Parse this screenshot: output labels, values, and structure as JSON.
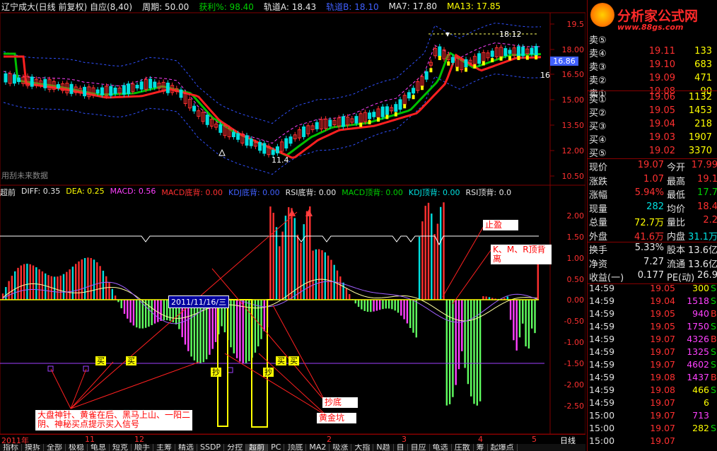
{
  "header": {
    "stock": "辽宁成大(日线 前复权) 自应(8,40)",
    "period": "周期: 50.00",
    "profit": "获利%: 98.40",
    "trackA": "轨道A: 18.43",
    "trackB": "轨道B: 18.10",
    "ma7": "MA7: 17.80",
    "ma13": "MA13: 17.85"
  },
  "main_axis": {
    "labels": [
      "19.5",
      "18.00",
      "16.50",
      "15.00",
      "13.50",
      "12.00",
      "10.50"
    ],
    "price_current": "16.86",
    "price_16": "16",
    "high_marker": "18.12",
    "low_marker": "11.4",
    "watermark": "用刮未来数据"
  },
  "sub_header": {
    "name": "超前",
    "diff": "DIFF: 0.35",
    "dea": "DEA: 0.25",
    "macd": "MACD: 0.56",
    "macd_div": "MACD底背: 0.00",
    "kdj_div": "KDJ底背: 0.00",
    "rsi_div": "RSI底背: 0.00",
    "macd_top": "MACD顶背: 0.00",
    "kdj_top": "KDJ顶背: 0.00",
    "rsi_top": "RSI顶背: 0.0"
  },
  "sub_axis": {
    "labels": [
      "2.00",
      "1.50",
      "1.00",
      "0.50",
      "0.00",
      "-0.50",
      "-1.00",
      "-1.50",
      "-2.00",
      "-2.50"
    ]
  },
  "annotations": {
    "stop_profit": "止盈",
    "top_div": "K、M、R顶背离",
    "bottom": "抄底",
    "golden_pit": "黄金坑",
    "buy_note": "大盘神针、黄雀在后、黑马上山、一阳二阴、神秘买点提示买入信号",
    "date_popup": "2011/11/16/三",
    "buy1": "买",
    "buy2": "买",
    "buy3": "买",
    "buy4": "买",
    "chao": "抄",
    "chao2": "抄"
  },
  "date_axis": {
    "labels": [
      "2011年",
      "11",
      "12",
      "2",
      "3",
      "4",
      "5"
    ],
    "period": "日线"
  },
  "tabs": [
    "指标",
    "摸拆",
    "全部",
    "极稳",
    "龟息",
    "短克",
    "顺手",
    "主筹",
    "精选",
    "SSDP",
    "分控",
    "超前",
    "PC",
    "顶底",
    "MA2",
    "吸涨",
    "大指",
    "N趋",
    "自",
    "自应",
    "龟选",
    "庄散",
    "筹",
    "起爆点"
  ],
  "right_panel": {
    "logo": "分析家公式网",
    "logo_url": "www.88gs.com",
    "sell": [
      {
        "label": "卖⑤",
        "price": "",
        "vol": ""
      },
      {
        "label": "卖④",
        "price": "19.11",
        "vol": "133"
      },
      {
        "label": "卖③",
        "price": "19.10",
        "vol": "683"
      },
      {
        "label": "卖②",
        "price": "19.09",
        "vol": "471"
      },
      {
        "label": "卖①",
        "price": "19.08",
        "vol": "90"
      }
    ],
    "buy": [
      {
        "label": "买①",
        "price": "19.06",
        "vol": "1132"
      },
      {
        "label": "买②",
        "price": "19.05",
        "vol": "1453"
      },
      {
        "label": "买③",
        "price": "19.04",
        "vol": "218"
      },
      {
        "label": "买④",
        "price": "19.03",
        "vol": "1907"
      },
      {
        "label": "买⑤",
        "price": "19.02",
        "vol": "3370"
      }
    ],
    "quote": [
      {
        "a": "现价",
        "b": "19.07",
        "c": "今开",
        "d": "17.99"
      },
      {
        "a": "涨跌",
        "b": "1.07",
        "c": "最高",
        "d": "19.1"
      },
      {
        "a": "涨幅",
        "b": "5.94%",
        "c": "最低",
        "d": "17.7"
      },
      {
        "a": "现量",
        "b": "282",
        "c": "均价",
        "d": "18.4"
      },
      {
        "a": "总量",
        "b": "72.7万",
        "c": "量比",
        "d": "2.2"
      },
      {
        "a": "外盘",
        "b": "41.6万",
        "c": "内盘",
        "d": "31.1万"
      },
      {
        "a": "换手",
        "b": "5.33%",
        "c": "股本",
        "d": "13.6亿"
      },
      {
        "a": "净资",
        "b": "7.27",
        "c": "流通",
        "d": "13.6亿"
      },
      {
        "a": "收益(一)",
        "b": "0.177",
        "c": "PE(动)",
        "d": "26.9"
      }
    ],
    "ticks": [
      {
        "t": "14:59",
        "p": "19.05",
        "v": "300",
        "f": "S",
        "vc": "yellow"
      },
      {
        "t": "14:59",
        "p": "19.04",
        "v": "1518",
        "f": "S",
        "vc": "mag"
      },
      {
        "t": "14:59",
        "p": "19.05",
        "v": "940",
        "f": "B",
        "vc": "mag"
      },
      {
        "t": "14:59",
        "p": "19.05",
        "v": "1750",
        "f": "S",
        "vc": "mag"
      },
      {
        "t": "14:59",
        "p": "19.07",
        "v": "4326",
        "f": "B",
        "vc": "mag"
      },
      {
        "t": "14:59",
        "p": "19.07",
        "v": "1325",
        "f": "S",
        "vc": "mag"
      },
      {
        "t": "14:59",
        "p": "19.07",
        "v": "4602",
        "f": "S",
        "vc": "mag"
      },
      {
        "t": "14:59",
        "p": "19.08",
        "v": "1437",
        "f": "B",
        "vc": "mag"
      },
      {
        "t": "14:59",
        "p": "19.08",
        "v": "466",
        "f": "S",
        "vc": "yellow"
      },
      {
        "t": "14:59",
        "p": "19.07",
        "v": "6",
        "f": "",
        "vc": "yellow"
      },
      {
        "t": "15:00",
        "p": "19.07",
        "v": "713",
        "f": "",
        "vc": "mag"
      },
      {
        "t": "15:00",
        "p": "19.07",
        "v": "282",
        "f": "S",
        "vc": "yellow"
      },
      {
        "t": "15:00",
        "p": "19.07",
        "v": "",
        "f": "",
        "vc": "yellow"
      }
    ]
  },
  "colors": {
    "up": "#ff3030",
    "down": "#00e0e0",
    "ma_green": "#00c000",
    "ma_red": "#ff2020",
    "macd_pos": "#ff3030",
    "macd_neg": "#60ff60",
    "grid": "#800000"
  }
}
